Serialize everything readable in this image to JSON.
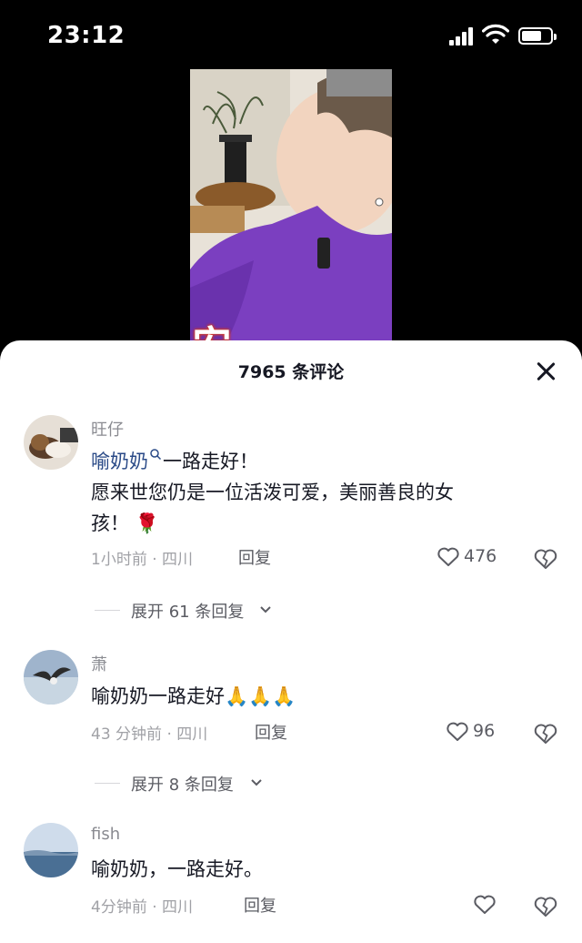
{
  "status_bar": {
    "time": "23:12"
  },
  "video": {
    "caption_char": "安"
  },
  "comments_sheet": {
    "title": "7965 条评论",
    "comments": [
      {
        "username": "旺仔",
        "mention": "喻奶奶",
        "text_line1": "一路走好！",
        "text_line2": "愿来世您仍是一位活泼可爱，美丽善良的女",
        "text_line3": "孩！",
        "emoji": "🌹",
        "time_location": "1小时前 · 四川",
        "reply_label": "回复",
        "likes": "476",
        "expand_label": "展开 61 条回复"
      },
      {
        "username": "萧",
        "text": "喻奶奶一路走好",
        "emoji": "🙏🙏🙏",
        "time_location": "43 分钟前 · 四川",
        "reply_label": "回复",
        "likes": "96",
        "expand_label": "展开 8 条回复"
      },
      {
        "username": "fish",
        "text": "喻奶奶，一路走好。",
        "time_location": "4分钟前 · 四川",
        "reply_label": "回复"
      }
    ]
  },
  "colors": {
    "sheet_bg": "#ffffff",
    "text_primary": "#161823",
    "text_secondary": "#8a8b91",
    "mention": "#2a4a87"
  },
  "battery_level": 0.7
}
